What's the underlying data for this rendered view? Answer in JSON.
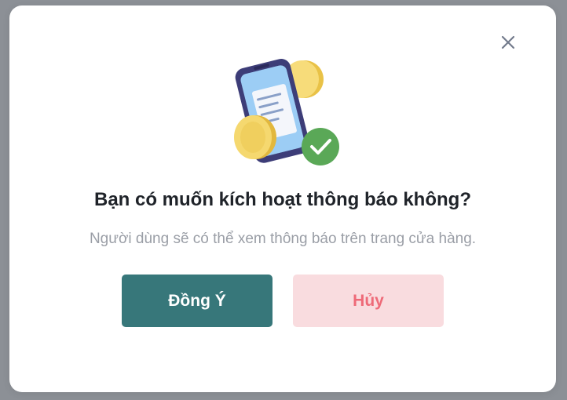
{
  "dialog": {
    "title": "Bạn có muốn kích hoạt thông báo không?",
    "description": "Người dùng sẽ có thể xem thông báo trên trang cửa hàng.",
    "confirm_label": "Đồng Ý",
    "cancel_label": "Hủy",
    "close_icon": "close-icon",
    "illustration_icon": "phone-coins-check-illustration"
  },
  "colors": {
    "confirm_bg": "#37777a",
    "cancel_bg": "#f9dcdf",
    "cancel_text": "#ee6a78",
    "check_green": "#5aa857"
  }
}
